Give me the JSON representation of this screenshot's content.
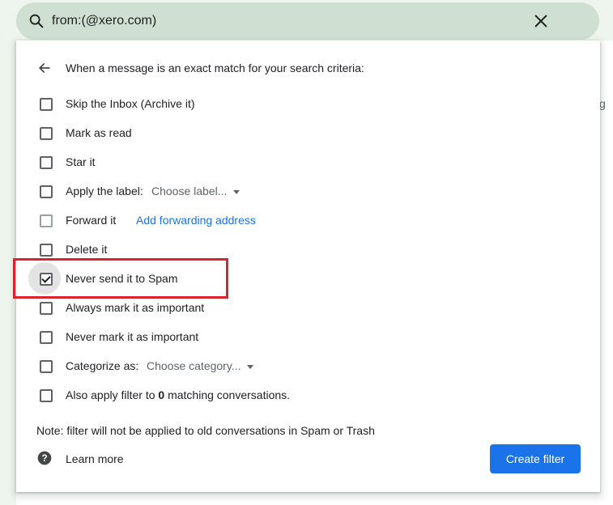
{
  "search": {
    "query": "from:(@xero.com)"
  },
  "background": {
    "partial_text": "g"
  },
  "dialog": {
    "header": "When a message is an exact match for your search criteria:",
    "options": [
      {
        "label": "Skip the Inbox (Archive it)",
        "checked": false
      },
      {
        "label": "Mark as read",
        "checked": false
      },
      {
        "label": "Star it",
        "checked": false
      },
      {
        "label": "Apply the label:",
        "select": "Choose label...",
        "checked": false
      },
      {
        "label": "Forward it",
        "link": "Add forwarding address",
        "checked": false,
        "disabled": true
      },
      {
        "label": "Delete it",
        "checked": false
      },
      {
        "label": "Never send it to Spam",
        "checked": true
      },
      {
        "label": "Always mark it as important",
        "checked": false
      },
      {
        "label": "Never mark it as important",
        "checked": false
      },
      {
        "label": "Categorize as:",
        "select": "Choose category...",
        "checked": false
      },
      {
        "label_prefix": "Also apply filter to",
        "count": "0",
        "label_suffix": "matching conversations.",
        "checked": false
      }
    ],
    "note": "Note: filter will not be applied to old conversations in Spam or Trash",
    "learn_more": "Learn more",
    "create_button": "Create filter"
  },
  "colors": {
    "accent": "#1a73e8",
    "highlight": "#d9232d",
    "search_bg": "#cfe0d2"
  }
}
